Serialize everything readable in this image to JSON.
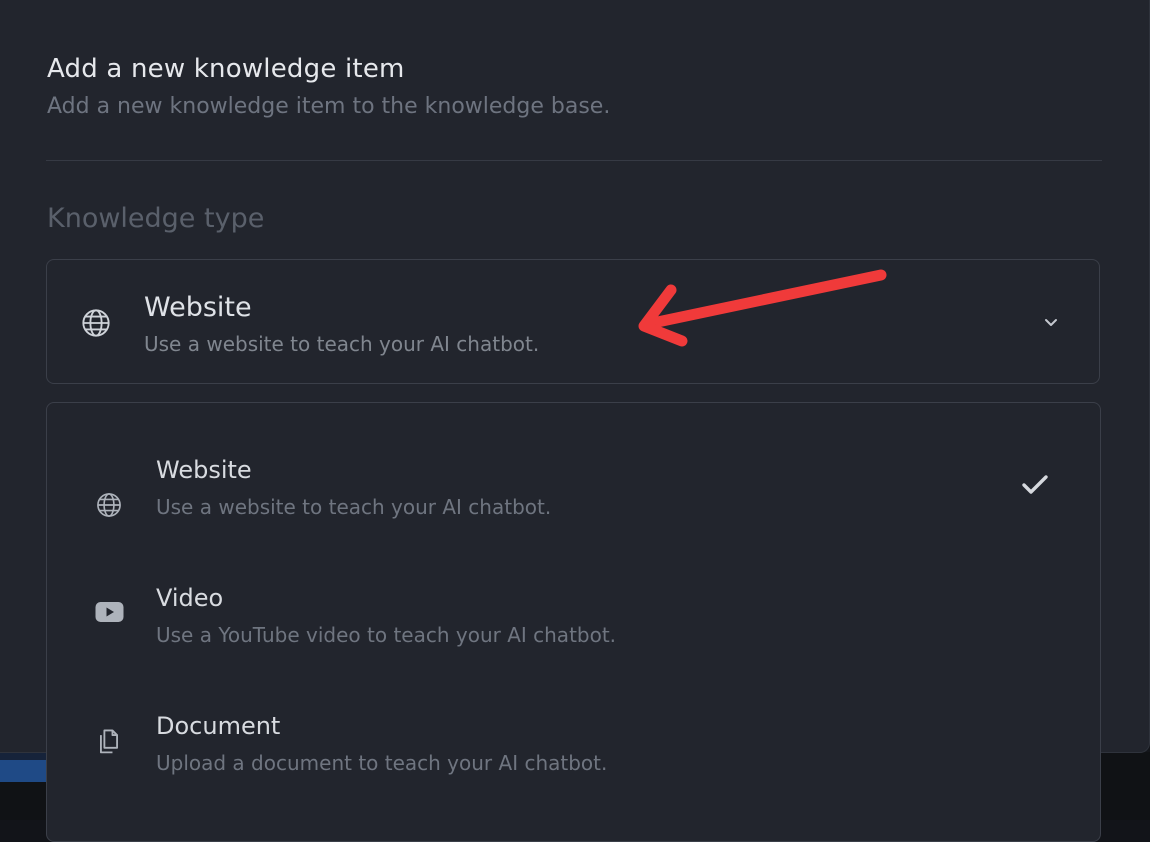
{
  "dialog": {
    "title": "Add a new knowledge item",
    "description": "Add a new knowledge item to the knowledge base."
  },
  "field": {
    "label": "Knowledge type"
  },
  "select": {
    "selected_title": "Website",
    "selected_description": "Use a website to teach your AI chatbot.",
    "selected_icon": "globe-icon",
    "open": true
  },
  "options": [
    {
      "title": "Website",
      "description": "Use a website to teach your AI chatbot.",
      "icon": "globe-icon",
      "selected": true
    },
    {
      "title": "Video",
      "description": "Use a YouTube video to teach your AI chatbot.",
      "icon": "youtube-icon",
      "selected": false
    },
    {
      "title": "Document",
      "description": "Upload a document to teach your AI chatbot.",
      "icon": "document-icon",
      "selected": false
    }
  ],
  "annotation": {
    "arrow_color": "#f03a3a"
  },
  "colors": {
    "dialog_bg": "#22252d",
    "border": "#3b3f49",
    "text_primary": "#dfe2e7",
    "text_muted": "#6f7580"
  }
}
